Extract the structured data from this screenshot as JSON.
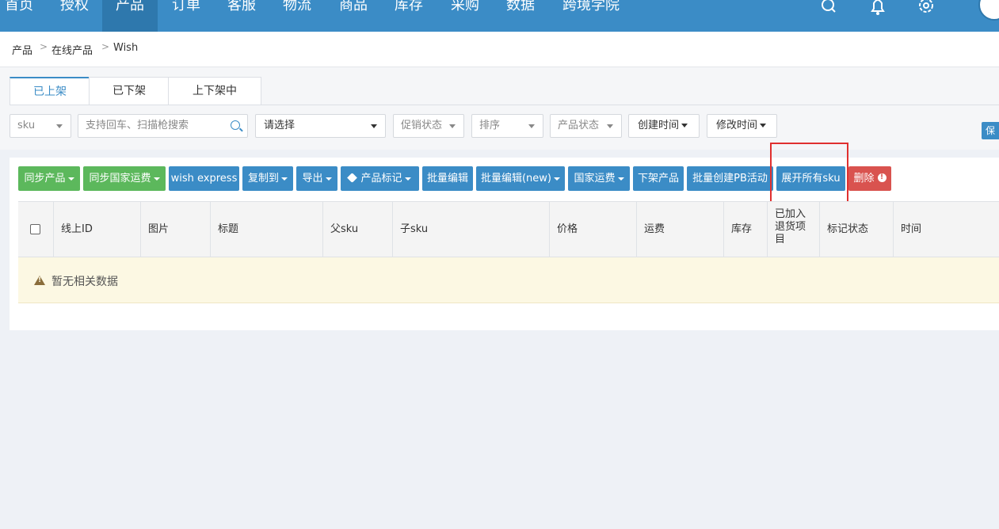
{
  "nav": {
    "items": [
      {
        "label": "首页"
      },
      {
        "label": "授权"
      },
      {
        "label": "产品",
        "active": true
      },
      {
        "label": "订单"
      },
      {
        "label": "客服"
      },
      {
        "label": "物流"
      },
      {
        "label": "商品"
      },
      {
        "label": "库存"
      },
      {
        "label": "采购"
      },
      {
        "label": "数据"
      },
      {
        "label": "跨境学院"
      }
    ],
    "icons": [
      "search-icon",
      "bell-icon",
      "gear-icon",
      "user-avatar-icon"
    ]
  },
  "breadcrumb": {
    "items": [
      "产品",
      "在线产品",
      "Wish"
    ],
    "separator": ">"
  },
  "tabs": [
    {
      "label": "已上架",
      "active": true
    },
    {
      "label": "已下架"
    },
    {
      "label": "上下架中"
    }
  ],
  "filters": {
    "sku_select": "sku",
    "search_placeholder": "支持回车、扫描枪搜索",
    "select_placeholder": "请选择",
    "promo_status": "促销状态",
    "sort": "排序",
    "product_status": "产品状态",
    "created_time": "创建时间",
    "modified_time": "修改时间",
    "save_label": "保"
  },
  "actions": {
    "sync_products": "同步产品",
    "sync_country_shipping": "同步国家运费",
    "wish_express": "wish express",
    "copy_to": "复制到",
    "export": "导出",
    "product_tag": "产品标记",
    "batch_edit": "批量编辑",
    "batch_edit_new": "批量编辑(new)",
    "country_shipping": "国家运费",
    "delist": "下架产品",
    "batch_pb": "批量创建PB活动",
    "expand_all_sku": "展开所有sku",
    "delete": "删除"
  },
  "table": {
    "columns": [
      "线上ID",
      "图片",
      "标题",
      "父sku",
      "子sku",
      "价格",
      "运费",
      "库存",
      "已加入退货项目",
      "标记状态",
      "时间"
    ],
    "empty_text": "暂无相关数据"
  },
  "colors": {
    "primary": "#3b8cc6",
    "success": "#5cb85c",
    "danger": "#d9534f",
    "highlight": "#e0302f"
  }
}
